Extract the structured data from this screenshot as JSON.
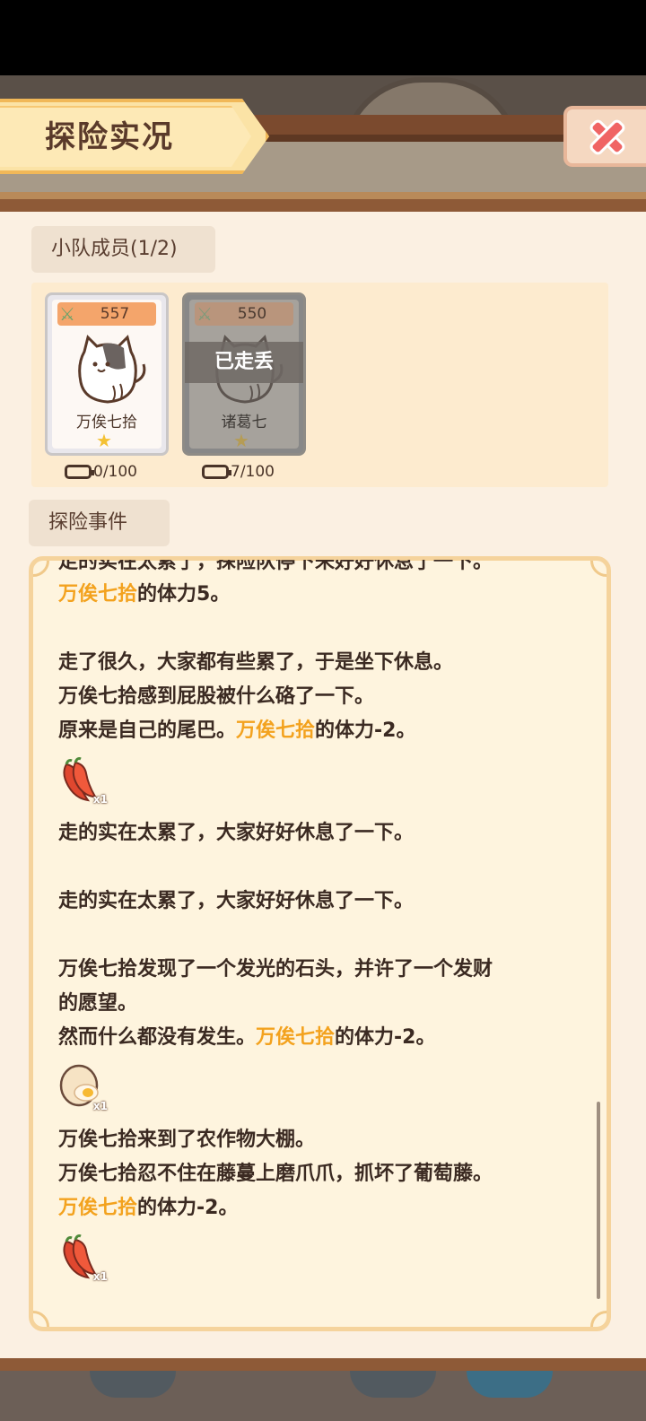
{
  "header": {
    "title": "探险实况"
  },
  "team": {
    "label": "小队成员(1/2)",
    "members": [
      {
        "power": "557",
        "name": "万俟七拾",
        "stamina": "0/100",
        "status": ""
      },
      {
        "power": "550",
        "name": "诸葛七",
        "stamina": "7/100",
        "status": "已走丢"
      }
    ]
  },
  "events": {
    "label": "探险事件",
    "lines": [
      {
        "segments": [
          "走的实在太累了，探险队停下来好好休息了一下。"
        ]
      },
      {
        "segments": [
          "万俟七拾",
          "的体力5。"
        ]
      },
      {
        "segments": [
          "走了很久，大家都有些累了，于是坐下休息。"
        ]
      },
      {
        "segments": [
          "万俟七拾感到屁股被什么硌了一下。"
        ]
      },
      {
        "segments": [
          "原来是自己的尾巴。",
          "万俟七拾",
          "的体力-2。"
        ]
      },
      {
        "segments": [
          "走的实在太累了，大家好好休息了一下。"
        ]
      },
      {
        "segments": [
          "走的实在太累了，大家好好休息了一下。"
        ]
      },
      {
        "segments": [
          "万俟七拾发现了一个发光的石头，并许了一个发财"
        ]
      },
      {
        "segments": [
          "的愿望。"
        ]
      },
      {
        "segments": [
          "然而什么都没有发生。",
          "万俟七拾",
          "的体力-2。"
        ]
      },
      {
        "segments": [
          "万俟七拾来到了农作物大棚。"
        ]
      },
      {
        "segments": [
          "万俟七拾忍不住在藤蔓上磨爪爪，抓坏了葡萄藤。"
        ]
      },
      {
        "segments": [
          "万俟七拾",
          "的体力-2。"
        ]
      }
    ],
    "items": [
      {
        "icon": "chili-pepper-icon",
        "qty": "x1"
      },
      {
        "icon": "egg-icon",
        "qty": "x1"
      },
      {
        "icon": "chili-pepper-icon",
        "qty": "x1"
      }
    ]
  },
  "colors": {
    "highlight": "#f3a21e",
    "text": "#3b2a22",
    "panel_bg": "#fbf0e2"
  }
}
